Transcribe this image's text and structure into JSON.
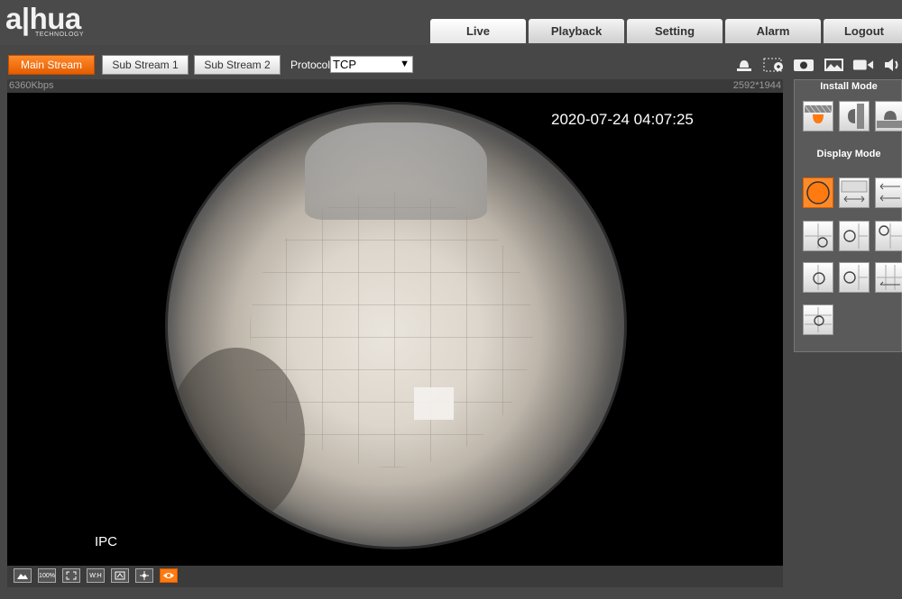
{
  "brand": {
    "logo_text": "a|hua",
    "logo_sub": "TECHNOLOGY"
  },
  "nav": {
    "tabs": [
      {
        "label": "Live",
        "active": true
      },
      {
        "label": "Playback",
        "active": false
      },
      {
        "label": "Setting",
        "active": false
      },
      {
        "label": "Alarm",
        "active": false
      },
      {
        "label": "Logout",
        "active": false
      }
    ]
  },
  "streams": {
    "main": "Main Stream",
    "sub1": "Sub Stream 1",
    "sub2": "Sub Stream 2",
    "selected": "Main Stream"
  },
  "protocol": {
    "label": "Protocol",
    "value": "TCP"
  },
  "toolbar_icons": [
    "alarm-output-icon",
    "zoom-region-icon",
    "snapshot-icon",
    "triple-snapshot-icon",
    "record-icon",
    "audio-icon"
  ],
  "stats": {
    "bitrate": "6360Kbps",
    "resolution": "2592*1944"
  },
  "video": {
    "timestamp": "2020-07-24 04:07:25",
    "channel_label": "IPC"
  },
  "bottom_icons": [
    {
      "name": "original-size-icon",
      "label": ""
    },
    {
      "name": "zoom-100-icon",
      "label": "100%"
    },
    {
      "name": "fullscreen-icon",
      "label": ""
    },
    {
      "name": "aspect-ratio-icon",
      "label": "W:H"
    },
    {
      "name": "fluency-icon",
      "label": ""
    },
    {
      "name": "ptz-icon",
      "label": ""
    },
    {
      "name": "eye-icon",
      "label": ""
    }
  ],
  "panel": {
    "install_mode_title": "Install Mode",
    "install_modes": [
      "ceiling-mount-icon",
      "wall-mount-icon",
      "ground-mount-icon"
    ],
    "display_mode_title": "Display Mode",
    "display_modes": [
      "original-fisheye",
      "panorama-180",
      "panorama-360-split",
      "1p-3r",
      "2p",
      "1p-3r-alt",
      "1r-2p",
      "1r-3p",
      "1p-4r"
    ],
    "selected_display_mode": "original-fisheye"
  },
  "colors": {
    "accent": "#ff7a10",
    "bg": "#474747",
    "tab_bg": "#e6e6e6"
  }
}
